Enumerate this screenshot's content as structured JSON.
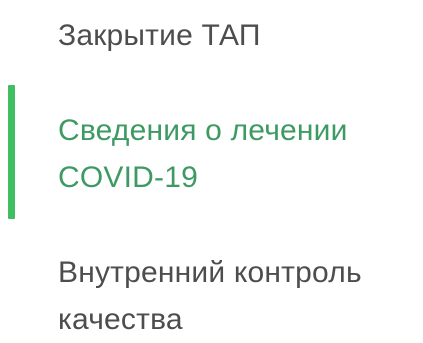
{
  "sidebar": {
    "accent_color": "#3fbf62",
    "active_text_color": "#3e9a63",
    "text_color": "#4d4d4d",
    "items": [
      {
        "label": "Закрытие ТАП",
        "active": false
      },
      {
        "label": "Сведения о лечении COVID-19",
        "active": true
      },
      {
        "label": "Внутренний контроль качества",
        "active": false
      }
    ]
  }
}
